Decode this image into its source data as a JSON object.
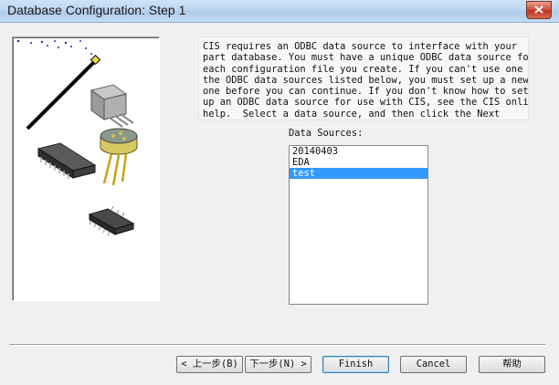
{
  "window": {
    "title": "Database Configuration: Step 1"
  },
  "description": {
    "lines": [
      "CIS requires an ODBC data source to interface with your",
      "part database. You must have a unique ODBC data source for",
      "each configuration file you create. If you can't use one of",
      "the ODBC data sources listed below, you must set up a new",
      "one before you can continue. If you don't know how to set",
      "up an ODBC data source for use with CIS, see the CIS online",
      "help.  Select a data source, and then click the Next"
    ]
  },
  "data_sources": {
    "label": "Data Sources:",
    "items": [
      "20140403",
      "EDA",
      "test"
    ],
    "selected": "test"
  },
  "buttons": {
    "back": "< 上一步(B)",
    "next": "下一步(N) >",
    "finish": "Finish",
    "cancel": "Cancel",
    "help": "帮助"
  },
  "icons": {
    "close": "close-icon",
    "wand": "magic-wand-icon",
    "to220": "to220-transistor-icon",
    "can": "to5-can-transistor-icon",
    "dip": "dip-chip-icon",
    "soic": "soic-chip-icon"
  }
}
